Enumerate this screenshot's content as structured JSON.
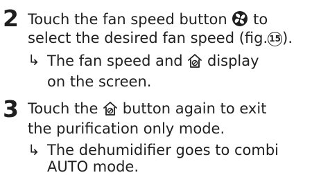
{
  "steps": [
    {
      "number": "2",
      "text_l1_a": "Touch the fan speed button",
      "text_l1_b": "to",
      "text_l2_a": "select the desired fan speed (fig.",
      "fig_number": "15",
      "text_l2_b": ").",
      "result_l1_a": "The fan speed and",
      "result_l1_b": "display",
      "result_l2": "on the screen."
    },
    {
      "number": "3",
      "text_l1_a": "Touch the",
      "text_l1_b": "button again to exit",
      "text_l2": "the purification only mode.",
      "result_l1": "The dehumidifier goes to combi",
      "result_l2": "AUTO mode."
    }
  ],
  "result_arrow": "↳",
  "icons": {
    "fan": "fan-speed-icon",
    "purification": "purification-mode-icon"
  }
}
